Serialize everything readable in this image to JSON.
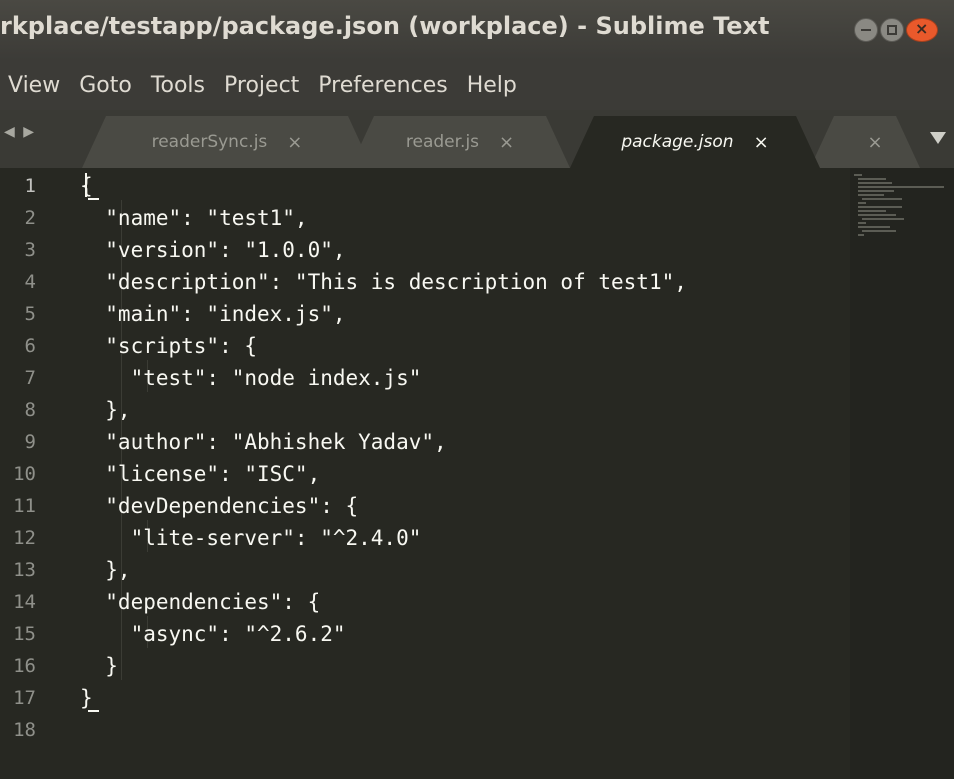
{
  "window": {
    "title": "rkplace/testapp/package.json (workplace) - Sublime Text",
    "close_glyph": "×"
  },
  "menu": [
    "View",
    "Goto",
    "Tools",
    "Project",
    "Preferences",
    "Help"
  ],
  "tabs": {
    "nav_arrows": "◀ ▶",
    "items": [
      {
        "label": "readerSync.js",
        "close": "×",
        "active": false
      },
      {
        "label": "reader.js",
        "close": "×",
        "active": false
      },
      {
        "label": "package.json",
        "close": "×",
        "active": true
      },
      {
        "label": "",
        "close": "×",
        "active": false
      }
    ],
    "dropdown_icon": "triangle-down-icon"
  },
  "editor": {
    "active_line": 1,
    "line_numbers": [
      "1",
      "2",
      "3",
      "4",
      "5",
      "6",
      "7",
      "8",
      "9",
      "10",
      "11",
      "12",
      "13",
      "14",
      "15",
      "16",
      "17",
      "18"
    ],
    "lines": [
      "{",
      "  \"name\": \"test1\",",
      "  \"version\": \"1.0.0\",",
      "  \"description\": \"This is description of test1\",",
      "  \"main\": \"index.js\",",
      "  \"scripts\": {",
      "    \"test\": \"node index.js\"",
      "  },",
      "  \"author\": \"Abhishek Yadav\",",
      "  \"license\": \"ISC\",",
      "  \"devDependencies\": {",
      "    \"lite-server\": \"^2.4.0\"",
      "  },",
      "  \"dependencies\": {",
      "    \"async\": \"^2.6.2\"",
      "  }",
      "}",
      ""
    ]
  },
  "colors": {
    "editor_bg": "#272822",
    "text": "#f8f8f2",
    "gutter_text": "#8f908a",
    "titlebar_bg": "#3c3b37",
    "close_button": "#e9592b"
  }
}
